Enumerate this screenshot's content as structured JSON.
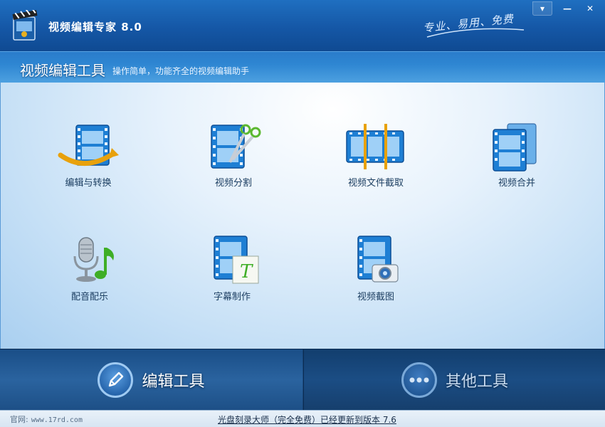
{
  "window": {
    "title": "视频编辑专家 8.0",
    "slogan": "专业、易用、免费",
    "controls": {
      "menu": "▾",
      "minimize": "—",
      "close": "✕"
    }
  },
  "header": {
    "title": "视频编辑工具",
    "subtitle": "操作简单，功能齐全的视频编辑助手"
  },
  "tools": [
    {
      "label": "编辑与转换",
      "icon": "film-convert-icon"
    },
    {
      "label": "视频分割",
      "icon": "film-scissors-icon"
    },
    {
      "label": "视频文件截取",
      "icon": "film-clip-icon"
    },
    {
      "label": "视频合并",
      "icon": "film-merge-icon"
    },
    {
      "label": "配音配乐",
      "icon": "microphone-music-icon"
    },
    {
      "label": "字幕制作",
      "icon": "film-subtitle-icon"
    },
    {
      "label": "视频截图",
      "icon": "film-camera-icon"
    }
  ],
  "tabs": {
    "edit": {
      "label": "编辑工具",
      "icon": "pencil-icon",
      "active": true
    },
    "other": {
      "label": "其他工具",
      "icon": "dots-icon",
      "active": false
    }
  },
  "statusbar": {
    "site_label": "官网:",
    "site_url": "www.17rd.com",
    "update_text": "光盘刻录大师（完全免费）已经更新到版本 7.6"
  },
  "colors": {
    "titlebar": "#1557a6",
    "header": "#2e86d2",
    "film_blue": "#1e7fd4",
    "text_dark": "#1d3f62"
  }
}
